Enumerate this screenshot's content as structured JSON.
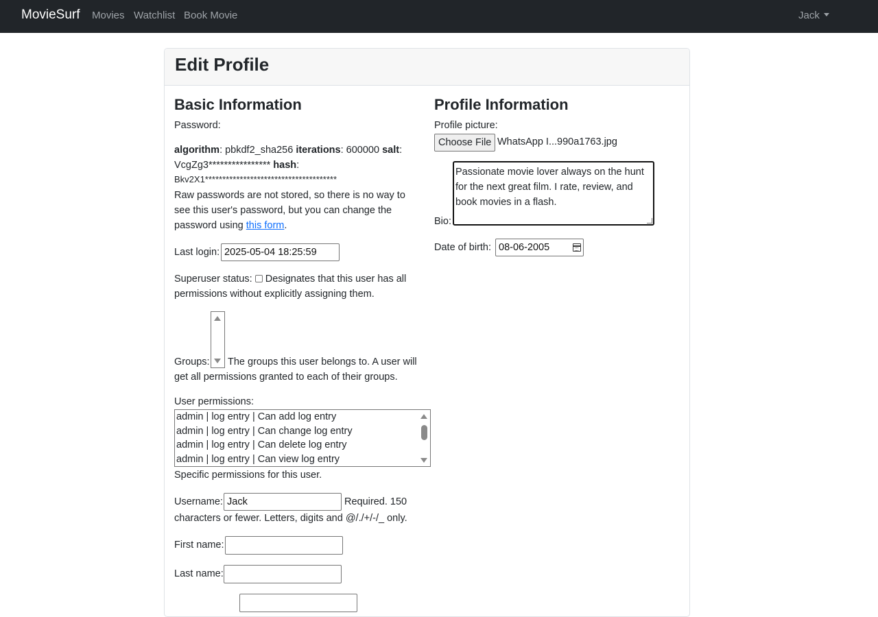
{
  "navbar": {
    "brand": "MovieSurf",
    "links": [
      "Movies",
      "Watchlist",
      "Book Movie"
    ],
    "user": "Jack"
  },
  "page": {
    "title": "Edit Profile"
  },
  "basic": {
    "heading": "Basic Information",
    "password_label": "Password:",
    "hash": {
      "algorithm_key": "algorithm",
      "algorithm_value": ": pbkdf2_sha256",
      "iterations_key": "iterations",
      "iterations_value": ": 600000",
      "salt_key": "salt",
      "salt_value": "VcgZg3****************",
      "hash_key": "hash",
      "hash_value": "Bkv2X1**************************************"
    },
    "password_help_pre": "Raw passwords are not stored, so there is no way to see this user's password, but you can change the password using ",
    "password_help_link": "this form",
    "password_help_post": ".",
    "last_login_label": "Last login:",
    "last_login_value": "2025-05-04 18:25:59",
    "superuser_label": "Superuser status:",
    "superuser_help": "Designates that this user has all permissions without explicitly assigning them.",
    "groups_label": "Groups:",
    "groups_help": "The groups this user belongs to. A user will get all permissions granted to each of their groups.",
    "permissions_label": "User permissions:",
    "permissions": [
      "admin | log entry | Can add log entry",
      "admin | log entry | Can change log entry",
      "admin | log entry | Can delete log entry",
      "admin | log entry | Can view log entry"
    ],
    "permissions_help": "Specific permissions for this user.",
    "username_label": "Username:",
    "username_value": "Jack",
    "username_help_a": "Required. 150",
    "username_help_b": "characters or fewer. Letters, digits and @/./+/-/_ only.",
    "first_name_label": "First name:",
    "first_name_value": "",
    "last_name_label": "Last name:",
    "last_name_value": ""
  },
  "profile": {
    "heading": "Profile Information",
    "picture_label": "Profile picture:",
    "file_button": "Choose File",
    "file_name": "WhatsApp I...990a1763.jpg",
    "bio_label": "Bio:",
    "bio_value": "Passionate movie lover always on the hunt for the next great film. I rate, review, and book movies in a flash.",
    "dob_label": "Date of birth:",
    "dob_value": "08-06-2005"
  },
  "icons": {
    "caret": "chevron-down-icon",
    "calendar": "calendar-icon",
    "scroll_up": "scroll-up-icon",
    "scroll_down": "scroll-down-icon"
  }
}
